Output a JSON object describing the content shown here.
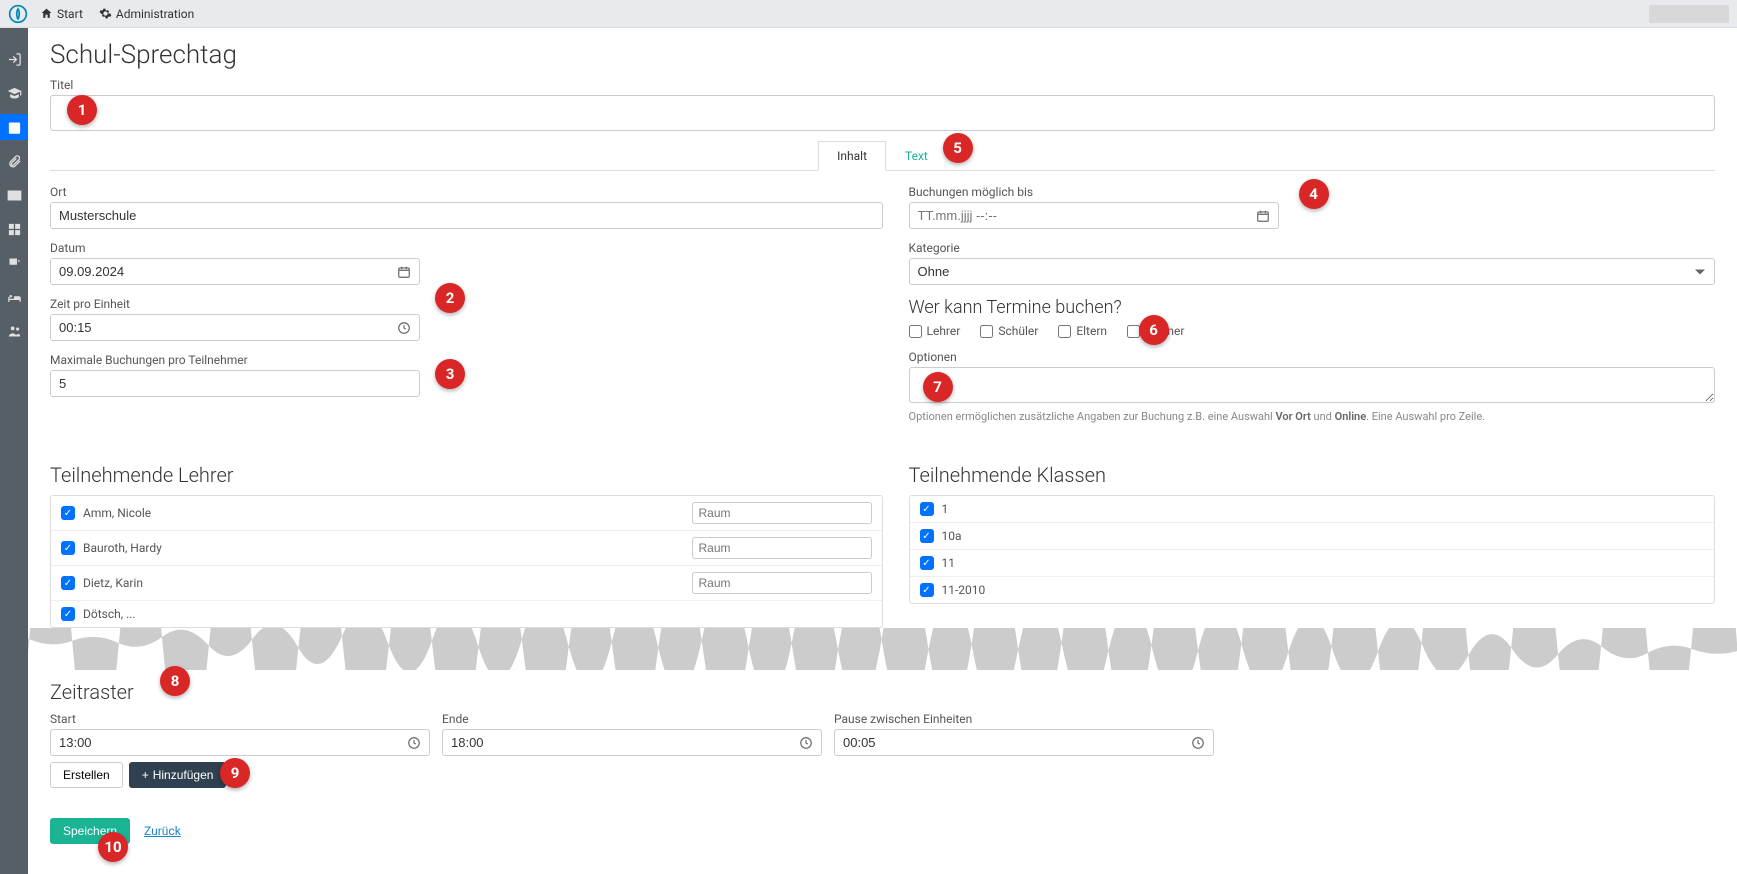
{
  "topbar": {
    "start": "Start",
    "admin": "Administration"
  },
  "page": {
    "title": "Schul-Sprechtag"
  },
  "fields": {
    "titel_label": "Titel",
    "titel_value": "",
    "ort_label": "Ort",
    "ort_value": "Musterschule",
    "datum_label": "Datum",
    "datum_value": "09.09.2024",
    "zeit_pro_einheit_label": "Zeit pro Einheit",
    "zeit_pro_einheit_value": "00:15",
    "max_buchungen_label": "Maximale Buchungen pro Teilnehmer",
    "max_buchungen_value": "5",
    "buchungen_bis_label": "Buchungen möglich bis",
    "buchungen_bis_placeholder": "TT.mm.jjjj --:--",
    "kategorie_label": "Kategorie",
    "kategorie_value": "Ohne",
    "optionen_label": "Optionen",
    "optionen_value": "",
    "optionen_help_prefix": "Optionen ermöglichen zusätzliche Angaben zur Buchung z.B. eine Auswahl ",
    "optionen_help_bold1": "Vor Ort",
    "optionen_help_mid": " und ",
    "optionen_help_bold2": "Online",
    "optionen_help_suffix": ". Eine Auswahl pro Zeile."
  },
  "tabs": {
    "inhalt": "Inhalt",
    "text": "Text"
  },
  "wer_kann": {
    "title": "Wer kann Termine buchen?",
    "lehrer": "Lehrer",
    "schueler": "Schüler",
    "eltern": "Eltern",
    "partner": "Partner"
  },
  "teilnehmende_lehrer": {
    "title": "Teilnehmende Lehrer",
    "raum_placeholder": "Raum",
    "items": [
      {
        "name": "Amm, Nicole"
      },
      {
        "name": "Bauroth, Hardy"
      },
      {
        "name": "Dietz, Karin"
      },
      {
        "name": "Dötsch, ..."
      }
    ]
  },
  "teilnehmende_klassen": {
    "title": "Teilnehmende Klassen",
    "items": [
      "1",
      "10a",
      "11",
      "11-2010"
    ]
  },
  "zeitraster": {
    "title": "Zeitraster",
    "start_label": "Start",
    "start_value": "13:00",
    "ende_label": "Ende",
    "ende_value": "18:00",
    "pause_label": "Pause zwischen Einheiten",
    "pause_value": "00:05",
    "erstellen": "Erstellen",
    "hinzufuegen": "Hinzufügen"
  },
  "actions": {
    "speichern": "Speichern",
    "zurueck": "Zurück"
  },
  "annotations": {
    "1": "1",
    "2": "2",
    "3": "3",
    "4": "4",
    "5": "5",
    "6": "6",
    "7": "7",
    "8": "8",
    "9": "9",
    "10": "10"
  }
}
